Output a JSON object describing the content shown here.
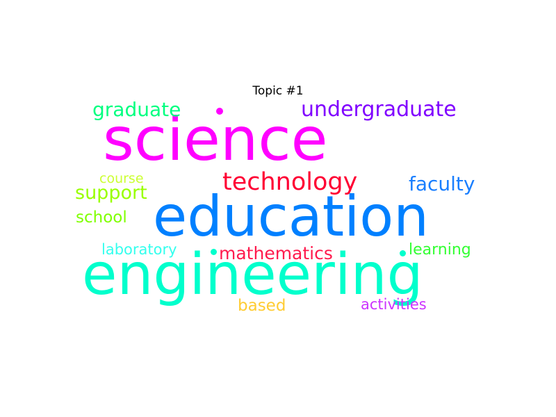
{
  "title": "Topic #1",
  "words": {
    "science": {
      "text": "science",
      "color": "#ff00ff"
    },
    "education": {
      "text": "education",
      "color": "#0080ff"
    },
    "engineering": {
      "text": "engineering",
      "color": "#00ffcc"
    },
    "undergraduate": {
      "text": "undergraduate",
      "color": "#8000ff"
    },
    "graduate": {
      "text": "graduate",
      "color": "#00ff80"
    },
    "technology": {
      "text": "technology",
      "color": "#ff0033"
    },
    "faculty": {
      "text": "faculty",
      "color": "#1a7fff"
    },
    "support": {
      "text": "support",
      "color": "#99ff00"
    },
    "course": {
      "text": "course",
      "color": "#ccff33"
    },
    "school": {
      "text": "school",
      "color": "#80ff00"
    },
    "laboratory": {
      "text": "laboratory",
      "color": "#33ffee"
    },
    "mathematics": {
      "text": "mathematics",
      "color": "#ff1a4d"
    },
    "learning": {
      "text": "learning",
      "color": "#33ff33"
    },
    "based": {
      "text": "based",
      "color": "#ffcc33"
    },
    "activities": {
      "text": "activities",
      "color": "#cc33ff"
    }
  },
  "dots": {
    "dot1": {
      "color": "#ff00ff"
    },
    "dot2": {
      "color": "#00ffcc"
    },
    "dot3": {
      "color": "#00ffcc"
    }
  }
}
